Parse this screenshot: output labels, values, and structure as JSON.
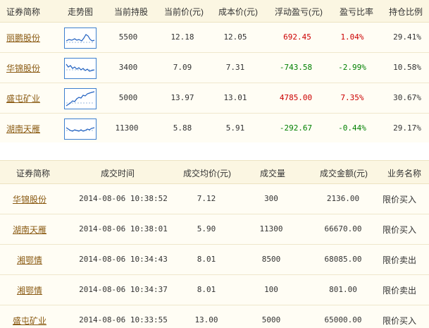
{
  "holdings": {
    "headers": {
      "name": "证券简称",
      "trend": "走势图",
      "shares": "当前持股",
      "price": "当前价(元)",
      "cost": "成本价(元)",
      "pnl": "浮动盈亏(元)",
      "ratio": "盈亏比率",
      "weight": "持仓比例"
    },
    "rows": [
      {
        "name": "丽鹏股份",
        "shares": "5500",
        "price": "12.18",
        "cost": "12.05",
        "pnl": "692.45",
        "ratio": "1.04%",
        "weight": "29.41%",
        "trend_icon": "sparkline-chart-icon"
      },
      {
        "name": "华锦股份",
        "shares": "3400",
        "price": "7.09",
        "cost": "7.31",
        "pnl": "-743.58",
        "ratio": "-2.99%",
        "weight": "10.58%",
        "trend_icon": "sparkline-chart-icon"
      },
      {
        "name": "盛屯矿业",
        "shares": "5000",
        "price": "13.97",
        "cost": "13.01",
        "pnl": "4785.00",
        "ratio": "7.35%",
        "weight": "30.67%",
        "trend_icon": "sparkline-chart-icon"
      },
      {
        "name": "湖南天雁",
        "shares": "11300",
        "price": "5.88",
        "cost": "5.91",
        "pnl": "-292.67",
        "ratio": "-0.44%",
        "weight": "29.17%",
        "trend_icon": "sparkline-chart-icon"
      }
    ]
  },
  "trades": {
    "headers": {
      "name": "证券简称",
      "time": "成交时间",
      "avg_price": "成交均价(元)",
      "volume": "成交量",
      "amount": "成交金额(元)",
      "business": "业务名称"
    },
    "rows": [
      {
        "name": "华锦股份",
        "time": "2014-08-06  10:38:52",
        "avg_price": "7.12",
        "volume": "300",
        "amount": "2136.00",
        "business": "限价买入"
      },
      {
        "name": "湖南天雁",
        "time": "2014-08-06  10:38:01",
        "avg_price": "5.90",
        "volume": "11300",
        "amount": "66670.00",
        "business": "限价买入"
      },
      {
        "name": "湘鄂情",
        "time": "2014-08-06  10:34:43",
        "avg_price": "8.01",
        "volume": "8500",
        "amount": "68085.00",
        "business": "限价卖出"
      },
      {
        "name": "湘鄂情",
        "time": "2014-08-06  10:34:37",
        "avg_price": "8.01",
        "volume": "100",
        "amount": "801.00",
        "business": "限价卖出"
      },
      {
        "name": "盛屯矿业",
        "time": "2014-08-06  10:33:55",
        "avg_price": "13.00",
        "volume": "5000",
        "amount": "65000.00",
        "business": "限价买入"
      }
    ]
  },
  "colors": {
    "profit": "#cc0000",
    "loss": "#008000",
    "link": "#8a5a12",
    "header_bg": "#fbf6e2",
    "row_bg": "#fffdf4",
    "sparkline_border": "#3d7fcf"
  }
}
